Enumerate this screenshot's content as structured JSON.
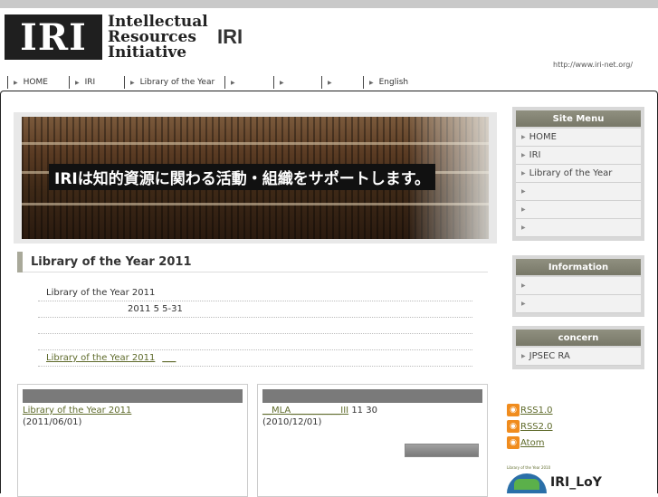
{
  "header": {
    "logo_mark": "IRI",
    "logo_line1": "Intellectual",
    "logo_line2": "Resources",
    "logo_line3": "Initiative",
    "site_title": "IRI",
    "site_url": "http://www.iri-net.org/"
  },
  "nav": {
    "items": [
      {
        "label": "HOME"
      },
      {
        "label": "IRI"
      },
      {
        "label": "Library of the Year"
      },
      {
        "label": ""
      },
      {
        "label": ""
      },
      {
        "label": ""
      },
      {
        "label": "English"
      }
    ]
  },
  "hero": {
    "caption": "IRIは知的資源に関わる活動・組織をサポートします。"
  },
  "section": {
    "title": "Library of the Year 2011",
    "line1": "Library of the Year 2011",
    "line2": "2011 5 5-31",
    "line3": "",
    "link": "Library of the Year 2011",
    "link_suffix": "___"
  },
  "cards": [
    {
      "link": "Library of the Year 2011",
      "date": "(2011/06/01)"
    },
    {
      "link": "__MLA___________III",
      "link_tail": "11 30",
      "date": "(2010/12/01)"
    }
  ],
  "sidebar": {
    "site_menu_title": "Site Menu",
    "site_menu_items": [
      "HOME",
      "IRI",
      "Library of the Year",
      "",
      "",
      ""
    ],
    "information_title": "Information",
    "information_items": [
      "",
      ""
    ],
    "concern_title": "concern",
    "concern_items": [
      "JPSEC RA"
    ]
  },
  "feeds": {
    "rss1": "RSS1.0",
    "rss2": "RSS2.0",
    "atom": "Atom"
  },
  "loy": {
    "small_text": "Library of the Year 2010",
    "name": "IRI_LoY"
  }
}
